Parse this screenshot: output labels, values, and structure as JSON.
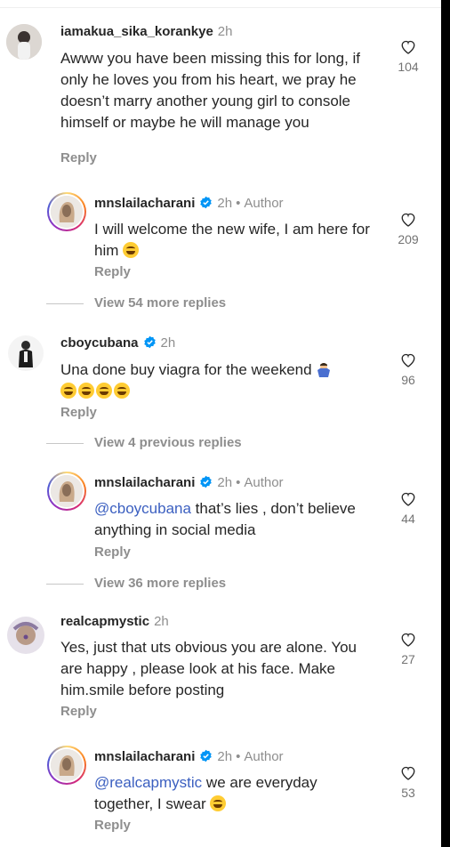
{
  "comments": [
    {
      "username": "iamakua_sika_korankye",
      "time": "2h",
      "text": "Awww you have been missing this for long, if only he loves you from his heart, we pray he doesn’t marry another young girl to console himself  or maybe he will manage you",
      "likes": "104",
      "reply_label": "Reply"
    },
    {
      "username": "mnslailacharani",
      "time": "2h",
      "author_label": "Author",
      "text": "I will welcome the new wife, I am here for him",
      "likes": "209",
      "reply_label": "Reply"
    },
    {
      "username": "cboycubana",
      "time": "2h",
      "text": "Una done buy viagra for the weekend",
      "likes": "96",
      "reply_label": "Reply"
    },
    {
      "username": "mnslailacharani",
      "time": "2h",
      "author_label": "Author",
      "mention": "@cboycubana",
      "text": " that’s lies , don’t believe anything in social media",
      "likes": "44",
      "reply_label": "Reply"
    },
    {
      "username": "realcapmystic",
      "time": "2h",
      "text": "Yes, just that uts obvious you are alone. You are happy , please look at his face. Make him.smile before posting",
      "likes": "27",
      "reply_label": "Reply"
    },
    {
      "username": "mnslailacharani",
      "time": "2h",
      "author_label": "Author",
      "mention": "@realcapmystic",
      "text": " we are everyday together, I swear",
      "likes": "53",
      "reply_label": "Reply"
    }
  ],
  "view_replies": [
    "View 54 more replies",
    "View 4 previous replies",
    "View 36 more replies"
  ],
  "icons": {
    "like": "heart-outline-icon",
    "verified": "verified-badge-icon",
    "emoji_laugh": "rolling-laughing-emoji",
    "emoji_grin": "grinning-squinting-emoji",
    "emoji_shrug": "person-shrugging-emoji"
  },
  "colors": {
    "mention": "#3b5fc0",
    "verified": "#0095f6",
    "muted": "#8e8e8e"
  }
}
